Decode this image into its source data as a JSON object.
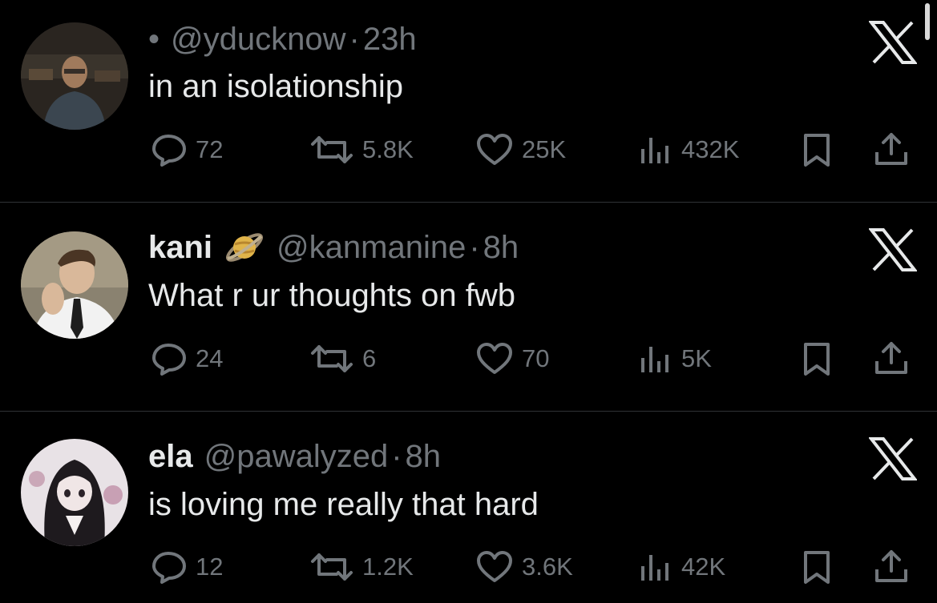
{
  "tweets": [
    {
      "leading_dot": "•",
      "name": "",
      "handle": "@yducknow",
      "separator": "·",
      "time": "23h",
      "text": "in an isolationship",
      "replies": "72",
      "reposts": "5.8K",
      "likes": "25K",
      "views": "432K",
      "avatar_icon": "man-glasses-avatar"
    },
    {
      "name": "kani",
      "badge_icon": "saturn-emoji",
      "handle": "@kanmanine",
      "separator": "·",
      "time": "8h",
      "text": "What r ur thoughts on fwb",
      "replies": "24",
      "reposts": "6",
      "likes": "70",
      "views": "5K",
      "avatar_icon": "man-tie-avatar"
    },
    {
      "name": "ela",
      "handle": "@pawalyzed",
      "separator": "·",
      "time": "8h",
      "text": "is loving me really that hard",
      "replies": "12",
      "reposts": "1.2K",
      "likes": "3.6K",
      "views": "42K",
      "avatar_icon": "anime-girl-avatar"
    }
  ],
  "colors": {
    "background": "#000000",
    "text_primary": "#e7e9ea",
    "text_secondary": "#71767b",
    "divider": "#2f3336"
  },
  "icons": [
    "reply-icon",
    "repost-icon",
    "like-icon",
    "views-icon",
    "bookmark-icon",
    "share-icon",
    "x-logo-icon"
  ]
}
